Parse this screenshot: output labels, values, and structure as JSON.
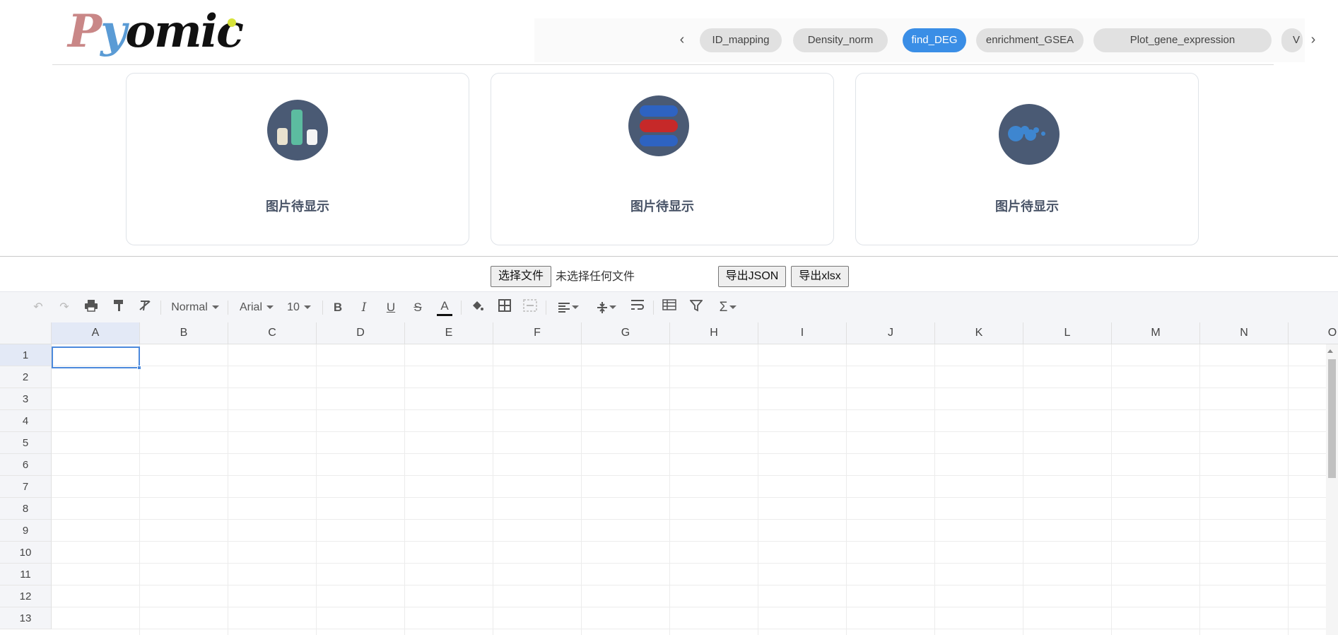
{
  "logo": {
    "p": "P",
    "y": "y",
    "rest": "omic"
  },
  "nav": {
    "prev_arrow": "‹",
    "next_arrow": "›",
    "tabs": [
      {
        "label": "ID_mapping"
      },
      {
        "label": "Density_norm"
      },
      {
        "label": "find_DEG",
        "active": true
      },
      {
        "label": "enrichment_GSEA"
      },
      {
        "label": "Plot_gene_expression"
      },
      {
        "label": "V"
      }
    ]
  },
  "cards": [
    {
      "icon": "bar-chart-icon",
      "caption": "图片待显示"
    },
    {
      "icon": "heatmap-bars-icon",
      "caption": "图片待显示"
    },
    {
      "icon": "bubble-chart-icon",
      "caption": "图片待显示"
    }
  ],
  "file": {
    "choose_label": "选择文件",
    "no_file_text": "未选择任何文件",
    "export_json_label": "导出JSON",
    "export_xlsx_label": "导出xlsx"
  },
  "toolbar": {
    "style_select": "Normal",
    "font_select": "Arial",
    "size_select": "10"
  },
  "sheet": {
    "columns": [
      "A",
      "B",
      "C",
      "D",
      "E",
      "F",
      "G",
      "H",
      "I",
      "J",
      "K",
      "L",
      "M",
      "N",
      "O"
    ],
    "rows": [
      "1",
      "2",
      "3",
      "4",
      "5",
      "6",
      "7",
      "8",
      "9",
      "10",
      "11",
      "12",
      "13"
    ],
    "selected_cell": "A1"
  },
  "colors": {
    "accent": "#3a8ee6",
    "pill_bg": "#e1e1e1",
    "icon_circle": "#4a5a74",
    "selection": "#4b89dc"
  }
}
